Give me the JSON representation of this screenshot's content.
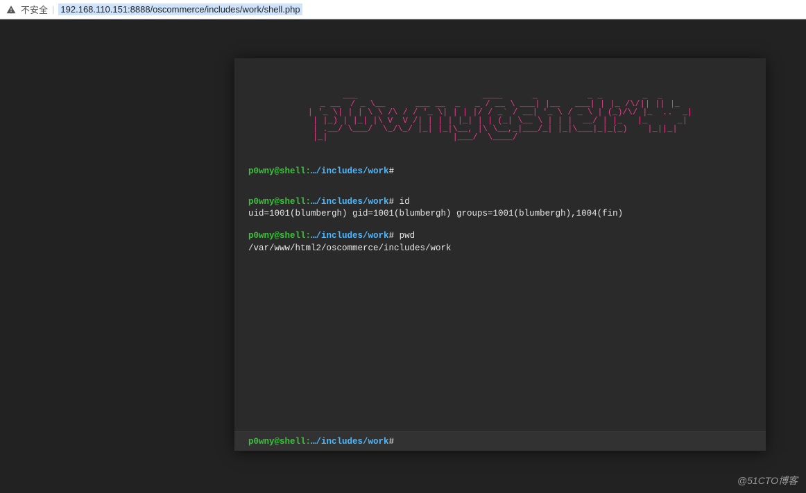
{
  "address_bar": {
    "not_secure_label": "不安全",
    "url": "192.168.110.151:8888/oscommerce/includes/work/shell.php"
  },
  "banner": {
    "ascii": "    ___                         ____      _          _ _        _  _   \n _ __  / _ \\__      ___ __  _   _ / __ \\ ___| |__   ___| | |_ /\\/|| || |_ \n| '_ \\| | | \\ \\ /\\ / / '_ \\| | | |/ / _` / __| '_ \\ / _ \\ | (_)/\\/ |_  ..  _|\n| |_) | |_| |\\ V  V /| | | | |_| | | (_| \\__ \\ | | |  __/ | |_   |_      _|\n| .__/ \\___/  \\_/\\_/ |_| |_|\\__, |\\ \\__,_|___/_| |_|\\___|_|_(_)    |_||_|  \n|_|                         |___/  \\____/                                  "
  },
  "prompt": {
    "user": "p0wny@shell",
    "path": "…/includes/work",
    "hash": "#"
  },
  "history": [
    {
      "cmd": "",
      "output": ""
    },
    {
      "cmd": "id",
      "output": "uid=1001(blumbergh) gid=1001(blumbergh) groups=1001(blumbergh),1004(fin)"
    },
    {
      "cmd": "pwd",
      "output": "/var/www/html2/oscommerce/includes/work"
    }
  ],
  "input": {
    "value": ""
  },
  "watermark": "@51CTO博客"
}
